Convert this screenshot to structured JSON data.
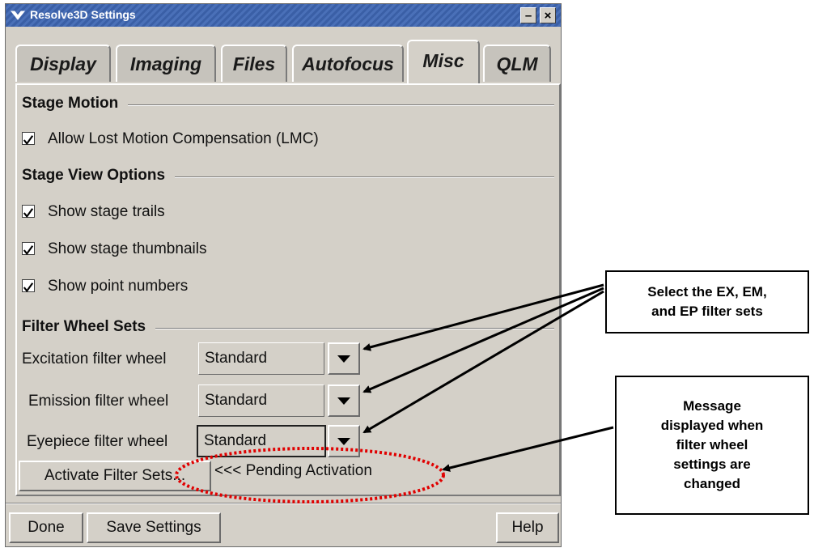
{
  "window": {
    "title": "Resolve3D Settings",
    "minimize_glyph": "–",
    "close_glyph": "×"
  },
  "tabs": [
    {
      "label": "Display",
      "active": false
    },
    {
      "label": "Imaging",
      "active": false
    },
    {
      "label": "Files",
      "active": false
    },
    {
      "label": "Autofocus",
      "active": false
    },
    {
      "label": "Misc",
      "active": true
    },
    {
      "label": "QLM",
      "active": false
    }
  ],
  "stage_motion": {
    "heading": "Stage Motion",
    "lmc": {
      "label": "Allow Lost Motion Compensation (LMC)",
      "checked": true
    }
  },
  "stage_view": {
    "heading": "Stage View Options",
    "options": [
      {
        "label": "Show stage trails",
        "checked": true
      },
      {
        "label": "Show stage thumbnails",
        "checked": true
      },
      {
        "label": "Show point numbers",
        "checked": true
      }
    ]
  },
  "filter_wheels": {
    "heading": "Filter Wheel Sets",
    "excitation": {
      "label": "Excitation filter wheel",
      "value": "Standard"
    },
    "emission": {
      "label": "Emission filter wheel",
      "value": "Standard"
    },
    "eyepiece": {
      "label": "Eyepiece filter wheel",
      "value": "Standard"
    },
    "activate_button": "Activate Filter Sets...",
    "status": "<<< Pending Activation"
  },
  "footer": {
    "done": "Done",
    "save": "Save Settings",
    "help": "Help"
  },
  "annotations": {
    "callout_select": [
      "Select the EX, EM,",
      "and EP filter sets"
    ],
    "callout_message": [
      "Message",
      "displayed when",
      "filter wheel",
      "settings are",
      "changed"
    ]
  },
  "colors": {
    "window_bg": "#d4d0c8",
    "titlebar": "#3a5fa6",
    "highlight_ellipse": "#e00000"
  }
}
